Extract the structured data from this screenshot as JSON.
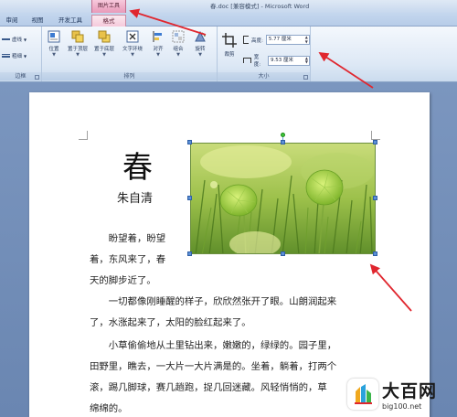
{
  "titlebar": {
    "context_group": "图片工具",
    "doc_title": "春.doc [兼容模式] - Microsoft Word"
  },
  "tabs": [
    {
      "label": "审阅"
    },
    {
      "label": "视图"
    },
    {
      "label": "开发工具"
    },
    {
      "label": "格式",
      "active": true
    }
  ],
  "ribbon": {
    "border_group": {
      "label": "边框",
      "line_style": "虚线",
      "weight": "粗细"
    },
    "arrange_group": {
      "label": "排列",
      "buttons": [
        {
          "label": "位置",
          "icon": "position-icon"
        },
        {
          "label": "置于顶层",
          "icon": "bring-front-icon"
        },
        {
          "label": "置于底层",
          "icon": "send-back-icon"
        },
        {
          "label": "文字环绕",
          "icon": "text-wrap-icon"
        },
        {
          "label": "对齐",
          "icon": "align-icon"
        },
        {
          "label": "组合",
          "icon": "group-icon"
        },
        {
          "label": "旋转",
          "icon": "rotate-icon"
        }
      ]
    },
    "size_group": {
      "label": "大小",
      "crop_label": "裁剪",
      "height_label": "高度:",
      "height_value": "5.77 厘米",
      "width_label": "宽度:",
      "width_value": "9.53 厘米"
    }
  },
  "document": {
    "title": "春",
    "author": "朱自清",
    "lines": [
      "　　盼望着，盼望",
      "着，东风来了，春",
      "天的脚步近了。",
      "　　一切都像刚睡醒的样子，欣欣然张开了眼。山朗润起来",
      "了，水涨起来了，太阳的脸红起来了。",
      "　　小草偷偷地从土里钻出来，嫩嫩的，绿绿的。园子里，",
      "田野里，瞧去，一大片一大片满是的。坐着，躺着，打两个",
      "滚，踢几脚球，赛几趟跑，捉几回迷藏。风轻悄悄的，草",
      "绵绵的。"
    ]
  },
  "watermark": {
    "title": "大百网",
    "url": "big100.net"
  },
  "colors": {
    "arrow": "#e0262e",
    "accent_tab": "#f5cadb",
    "doc_background": "#6f8cb6"
  }
}
